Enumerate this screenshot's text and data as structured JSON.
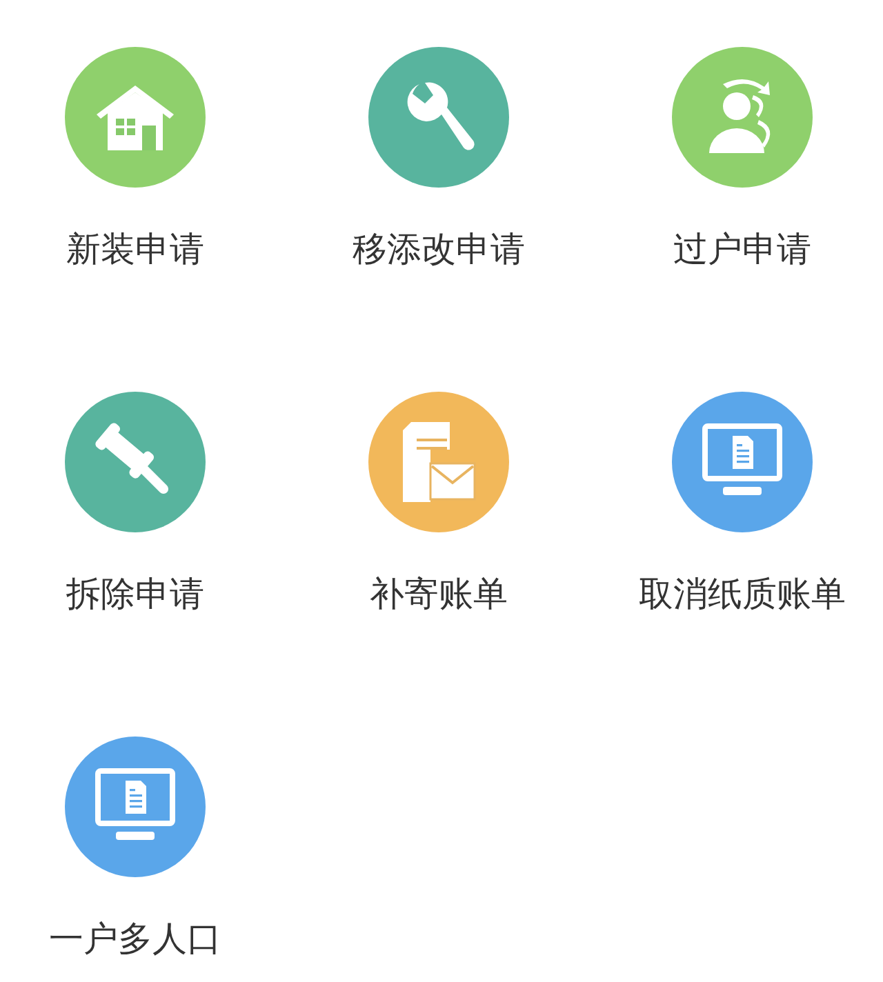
{
  "services": [
    {
      "label": "新装申请",
      "kind": "house",
      "color": "#8fd06c"
    },
    {
      "label": "移添改申请",
      "kind": "wrench",
      "color": "#58b49e"
    },
    {
      "label": "过户申请",
      "kind": "person",
      "color": "#8fd06c"
    },
    {
      "label": "拆除申请",
      "kind": "gavel",
      "color": "#58b49e"
    },
    {
      "label": "补寄账单",
      "kind": "mail",
      "color": "#f2b85a"
    },
    {
      "label": "取消纸质账单",
      "kind": "monitor",
      "color": "#5aa6ea"
    },
    {
      "label": "一户多人口",
      "kind": "monitor",
      "color": "#5aa6ea"
    }
  ]
}
